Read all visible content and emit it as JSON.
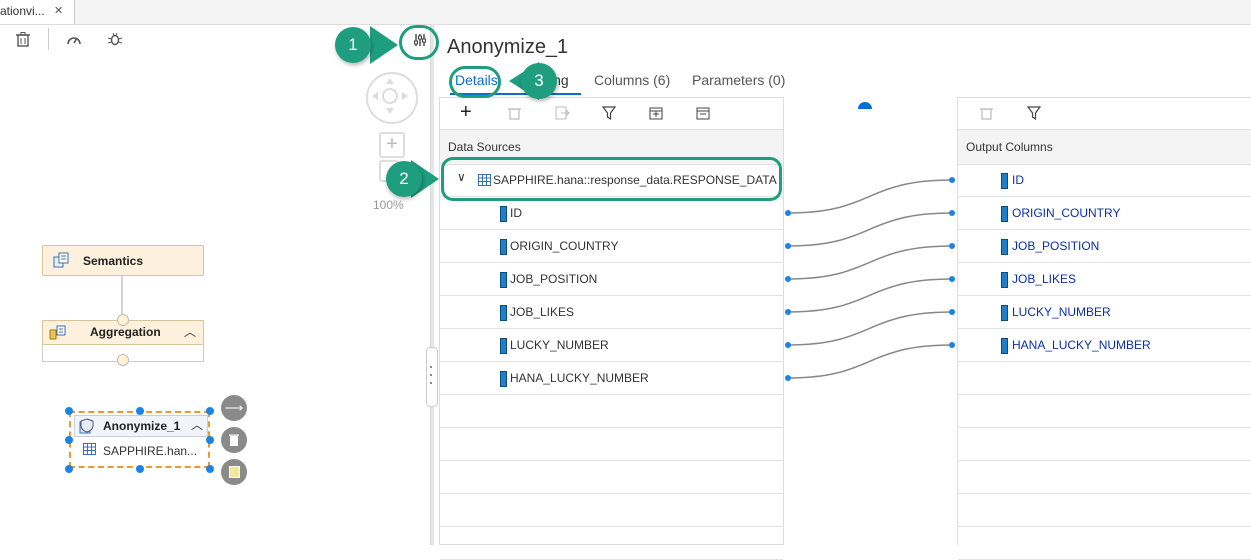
{
  "file_tab": {
    "label": "ationvi...",
    "close": "✕"
  },
  "editor": {
    "title": "Anonymize_1",
    "tabs": [
      "Details",
      "Mapping",
      "Columns (6)",
      "Parameters (0)"
    ],
    "details_visible": "Details",
    "mapping_visible": "ing"
  },
  "graph": {
    "zoom": "100%",
    "nodes": {
      "semantics": "Semantics",
      "aggregation": "Aggregation",
      "anonymize": "Anonymize_1",
      "anonymize_source": "SAPPHIRE.han..."
    }
  },
  "data_sources": {
    "header": "Data Sources",
    "source": "SAPPHIRE.hana::response_data.RESPONSE_DATA",
    "columns": [
      "ID",
      "ORIGIN_COUNTRY",
      "JOB_POSITION",
      "JOB_LIKES",
      "LUCKY_NUMBER",
      "HANA_LUCKY_NUMBER"
    ]
  },
  "output": {
    "header": "Output Columns",
    "columns": [
      "ID",
      "ORIGIN_COUNTRY",
      "JOB_POSITION",
      "JOB_LIKES",
      "LUCKY_NUMBER",
      "HANA_LUCKY_NUMBER"
    ]
  },
  "callouts": [
    "1",
    "2",
    "3"
  ],
  "colors": {
    "accent": "#0a6ed1",
    "callout": "#1e9e7e",
    "node_fill": "#fdf0dc",
    "output_text": "#0b2fa8"
  }
}
